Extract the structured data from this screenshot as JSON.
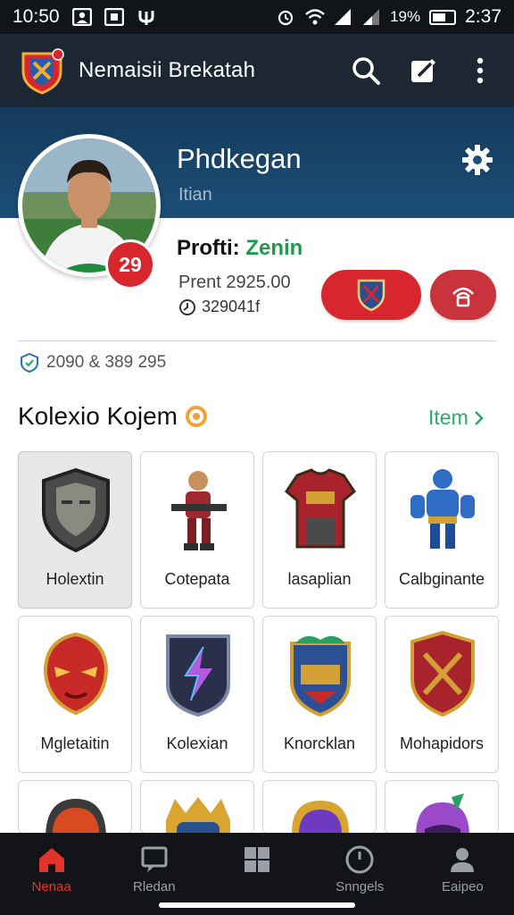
{
  "status_bar": {
    "time_left": "10:50",
    "battery_pct": "19%",
    "time_right": "2:37"
  },
  "app": {
    "title": "Nemaisii Brekatah"
  },
  "profile": {
    "name": "Phdkegan",
    "subtitle": "Itian",
    "level": "29",
    "label_prefix": "Profti: ",
    "label_accent": "Zenin",
    "points": "Prent 2925.00",
    "coins": "329041f",
    "stats": "2090 & 389 295"
  },
  "collection": {
    "title": "Kolexio Kojem",
    "link": "Item",
    "items": [
      {
        "label": "Holextin",
        "icon": "shield-mask-icon"
      },
      {
        "label": "Cotepata",
        "icon": "gunner-figure-icon"
      },
      {
        "label": "lasaplian",
        "icon": "armor-chestplate-icon"
      },
      {
        "label": "Calbginante",
        "icon": "blue-warrior-icon"
      },
      {
        "label": "Mgletaitin",
        "icon": "red-mask-icon"
      },
      {
        "label": "Kolexian",
        "icon": "lightning-shield-icon"
      },
      {
        "label": "Knorcklan",
        "icon": "emblem-shield-icon"
      },
      {
        "label": "Mohapidors",
        "icon": "crest-shield-icon"
      },
      {
        "label": "",
        "icon": "orange-helmet-icon"
      },
      {
        "label": "",
        "icon": "gold-helmet-icon"
      },
      {
        "label": "",
        "icon": "purple-helmet-icon"
      },
      {
        "label": "",
        "icon": "alien-helmet-icon"
      }
    ]
  },
  "nav": [
    {
      "label": "Nenaa",
      "icon": "home-icon"
    },
    {
      "label": "Rledan",
      "icon": "chat-icon"
    },
    {
      "label": "",
      "icon": "grid-icon"
    },
    {
      "label": "Snngels",
      "icon": "clock-icon"
    },
    {
      "label": "Eaipeo",
      "icon": "person-icon"
    }
  ],
  "colors": {
    "accent_red": "#d8262e",
    "header_dark": "#1c2733",
    "band_blue": "#1c4e78",
    "link_green": "#2aa866"
  }
}
